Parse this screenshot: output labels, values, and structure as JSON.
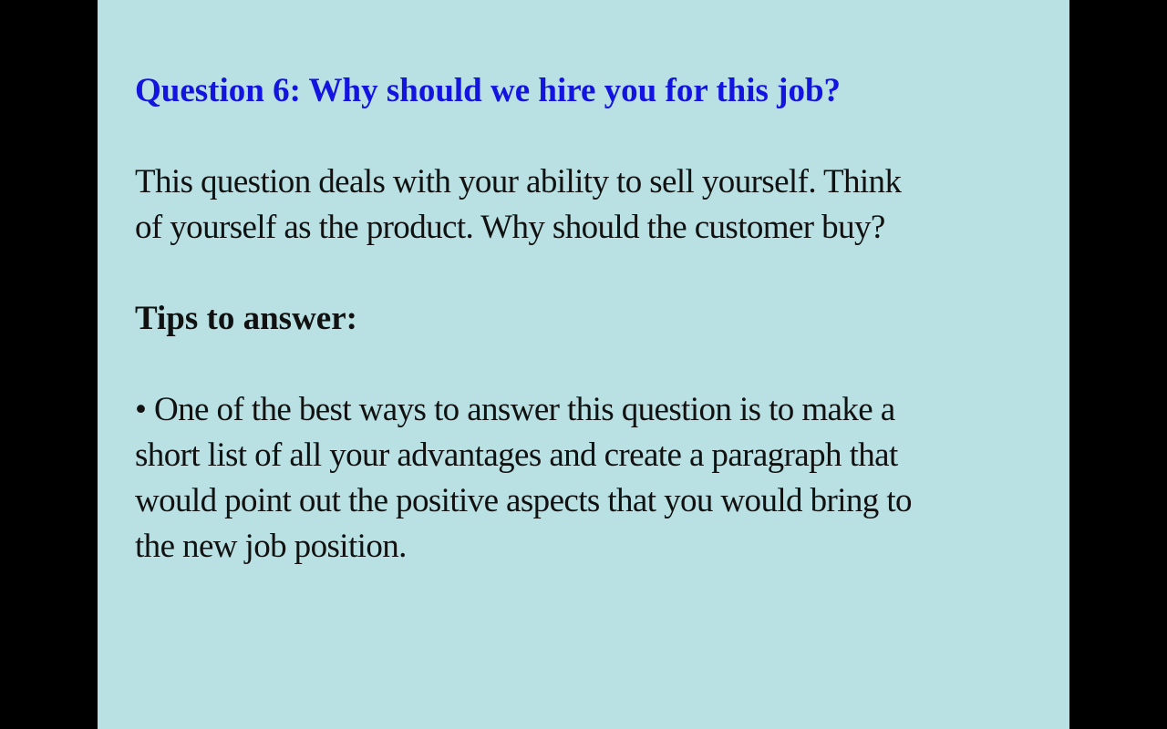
{
  "slide": {
    "title": "Question 6: Why should we hire you for this job?",
    "intro_lines": [
      "This question deals with your ability to sell yourself. Think",
      "of yourself as the product. Why should the customer buy?"
    ],
    "tips_heading": "Tips to answer:",
    "tip_lines": [
      "• One of the best ways to answer this question is to make a",
      "short list of all your advantages and create a paragraph that",
      "would point out the positive aspects that you would bring to",
      "the new job position."
    ],
    "colors": {
      "background": "#b9e0e2",
      "title": "#1414e0",
      "text": "#111111",
      "letterbox": "#000000"
    }
  }
}
